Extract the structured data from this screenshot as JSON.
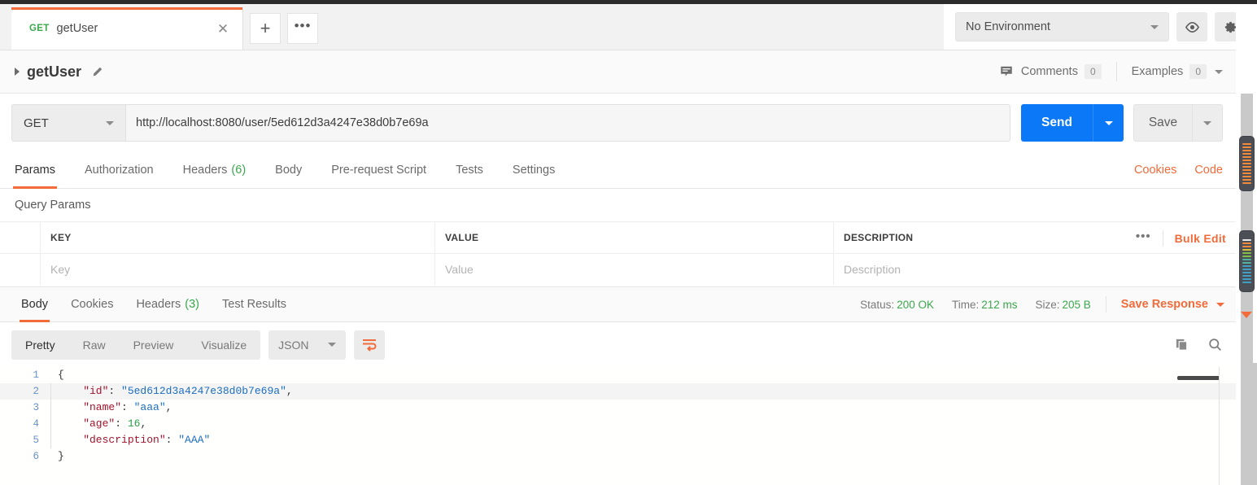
{
  "tab": {
    "method": "GET",
    "title": "getUser",
    "close_icon": "close-icon",
    "new_tab_label": "+",
    "more_label": "•••"
  },
  "environment": {
    "selected": "No Environment",
    "eye_icon": "eye-icon",
    "settings_icon": "gear-icon"
  },
  "request_header": {
    "name": "getUser",
    "edit_icon": "pencil-icon",
    "comments_label": "Comments",
    "comments_count": "0",
    "examples_label": "Examples",
    "examples_count": "0"
  },
  "url_bar": {
    "method": "GET",
    "url": "http://localhost:8080/user/5ed612d3a4247e38d0b7e69a",
    "send_label": "Send",
    "save_label": "Save"
  },
  "request_tabs": {
    "items": [
      {
        "label": "Params",
        "count": ""
      },
      {
        "label": "Authorization",
        "count": ""
      },
      {
        "label": "Headers",
        "count": "(6)"
      },
      {
        "label": "Body",
        "count": ""
      },
      {
        "label": "Pre-request Script",
        "count": ""
      },
      {
        "label": "Tests",
        "count": ""
      },
      {
        "label": "Settings",
        "count": ""
      }
    ],
    "active": "Params",
    "cookies_link": "Cookies",
    "code_link": "Code"
  },
  "query_params": {
    "section_title": "Query Params",
    "columns": [
      "KEY",
      "VALUE",
      "DESCRIPTION"
    ],
    "placeholder_row": {
      "key": "Key",
      "value": "Value",
      "description": "Description"
    },
    "dots_label": "•••",
    "bulk_edit_label": "Bulk Edit"
  },
  "response_tabs": {
    "items": [
      {
        "label": "Body",
        "count": ""
      },
      {
        "label": "Cookies",
        "count": ""
      },
      {
        "label": "Headers",
        "count": "(3)"
      },
      {
        "label": "Test Results",
        "count": ""
      }
    ],
    "active": "Body",
    "status_label": "Status:",
    "status_value": "200 OK",
    "time_label": "Time:",
    "time_value": "212 ms",
    "size_label": "Size:",
    "size_value": "205 B",
    "save_response_label": "Save Response"
  },
  "response_toolbar": {
    "segments": [
      "Pretty",
      "Raw",
      "Preview",
      "Visualize"
    ],
    "active_segment": "Pretty",
    "format": "JSON",
    "wrap_icon": "word-wrap-icon",
    "copy_icon": "copy-icon",
    "search_icon": "search-icon"
  },
  "response_body": {
    "language": "json",
    "lines": [
      {
        "num": "1",
        "tokens": [
          {
            "t": "p",
            "v": "{"
          }
        ]
      },
      {
        "num": "2",
        "tokens": [
          {
            "t": "k",
            "v": "    \"id\""
          },
          {
            "t": "p",
            "v": ": "
          },
          {
            "t": "s",
            "v": "\"5ed612d3a4247e38d0b7e69a\""
          },
          {
            "t": "p",
            "v": ","
          }
        ]
      },
      {
        "num": "3",
        "tokens": [
          {
            "t": "k",
            "v": "    \"name\""
          },
          {
            "t": "p",
            "v": ": "
          },
          {
            "t": "s",
            "v": "\"aaa\""
          },
          {
            "t": "p",
            "v": ","
          }
        ]
      },
      {
        "num": "4",
        "tokens": [
          {
            "t": "k",
            "v": "    \"age\""
          },
          {
            "t": "p",
            "v": ": "
          },
          {
            "t": "n",
            "v": "16"
          },
          {
            "t": "p",
            "v": ","
          }
        ]
      },
      {
        "num": "5",
        "tokens": [
          {
            "t": "k",
            "v": "    \"description\""
          },
          {
            "t": "p",
            "v": ": "
          },
          {
            "t": "s",
            "v": "\"AAA\""
          }
        ]
      },
      {
        "num": "6",
        "tokens": [
          {
            "t": "p",
            "v": "}"
          }
        ]
      }
    ],
    "highlight_line": 2
  },
  "colors": {
    "accent_orange": "#f26b3a",
    "send_blue": "#0b79f7",
    "success_green": "#3aa84c",
    "json_key": "#a3122b",
    "json_string": "#1c6ec1",
    "json_number": "#2c9e4b"
  },
  "scrollbars": {
    "thumb_a_stripes": [
      "#f08a3c",
      "#f08a3c",
      "#f08a3c",
      "#f08a3c",
      "#f08a3c",
      "#f08a3c",
      "#f08a3c",
      "#f08a3c",
      "#f08a3c",
      "#f08a3c",
      "#f08a3c",
      "#f08a3c",
      "#f08a3c"
    ],
    "thumb_b_stripes": [
      "#e8e8e8",
      "#f08a3c",
      "#f08a3c",
      "#d8c03a",
      "#7fbf4a",
      "#7fbf4a",
      "#4fb3a0",
      "#4fb3a0",
      "#3f9fc4",
      "#3f9fc4",
      "#3f9fc4",
      "#3f9fc4",
      "#3f9fc4",
      "#3f9fc4"
    ]
  }
}
